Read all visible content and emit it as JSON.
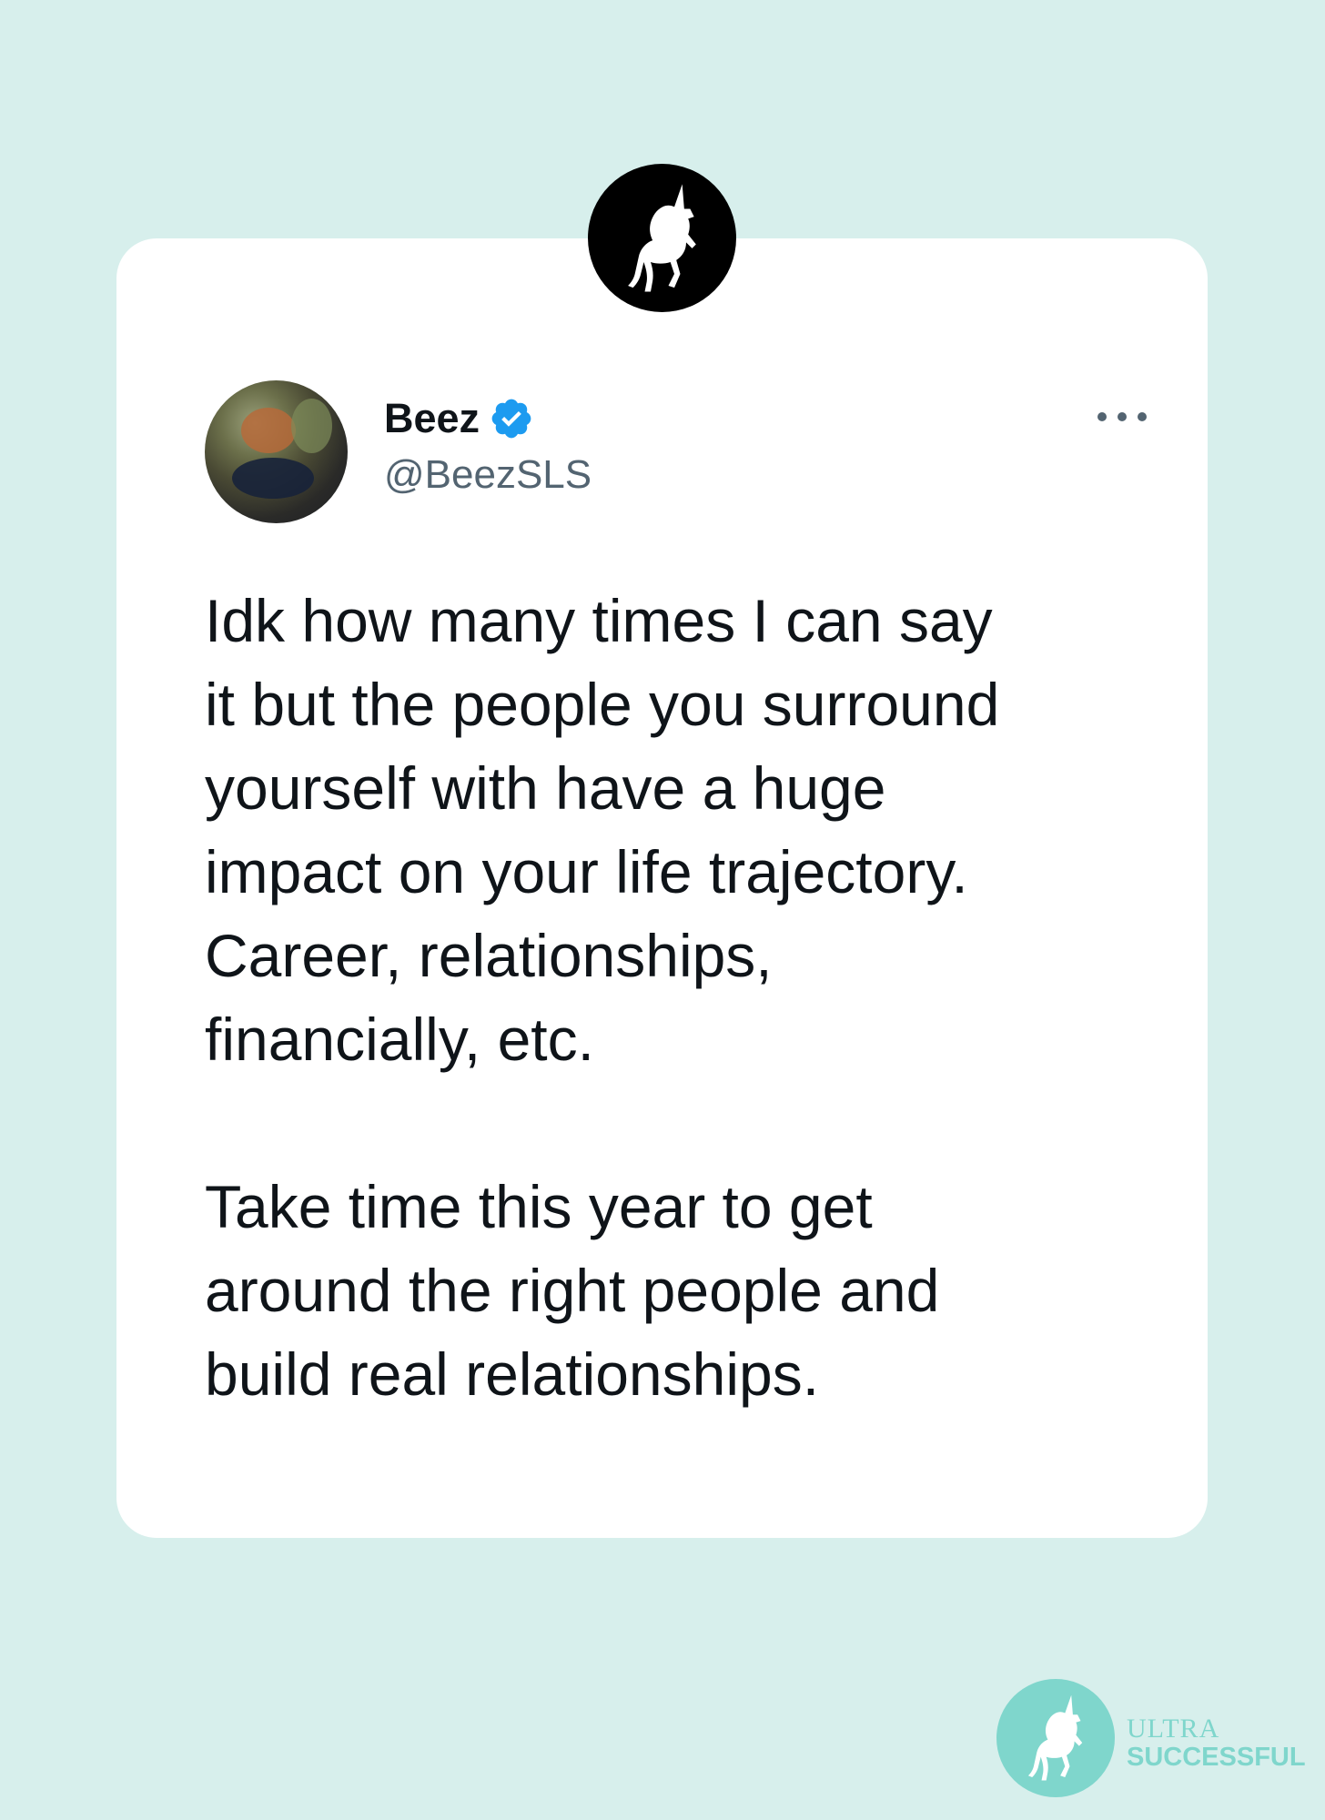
{
  "colors": {
    "background": "#d7efec",
    "card": "#ffffff",
    "text_primary": "#0f1419",
    "text_secondary": "#536471",
    "verified_blue": "#1d9bf0",
    "brand_teal": "#7fd6cc"
  },
  "icons": {
    "top_badge": "unicorn-icon",
    "verified": "verified-check-icon",
    "more": "more-options-icon",
    "brand": "unicorn-icon"
  },
  "tweet": {
    "display_name": "Beez",
    "handle": "@BeezSLS",
    "paragraphs": [
      "Idk how many times I can say\nit but the people you surround\nyourself with have a huge\nimpact on your life trajectory.\nCareer, relationships,\nfinancially, etc.",
      "Take time this year to get\naround the right people and\nbuild real relationships."
    ]
  },
  "brand": {
    "line1": "ULTRA",
    "line2": "SUCCESSFUL"
  }
}
